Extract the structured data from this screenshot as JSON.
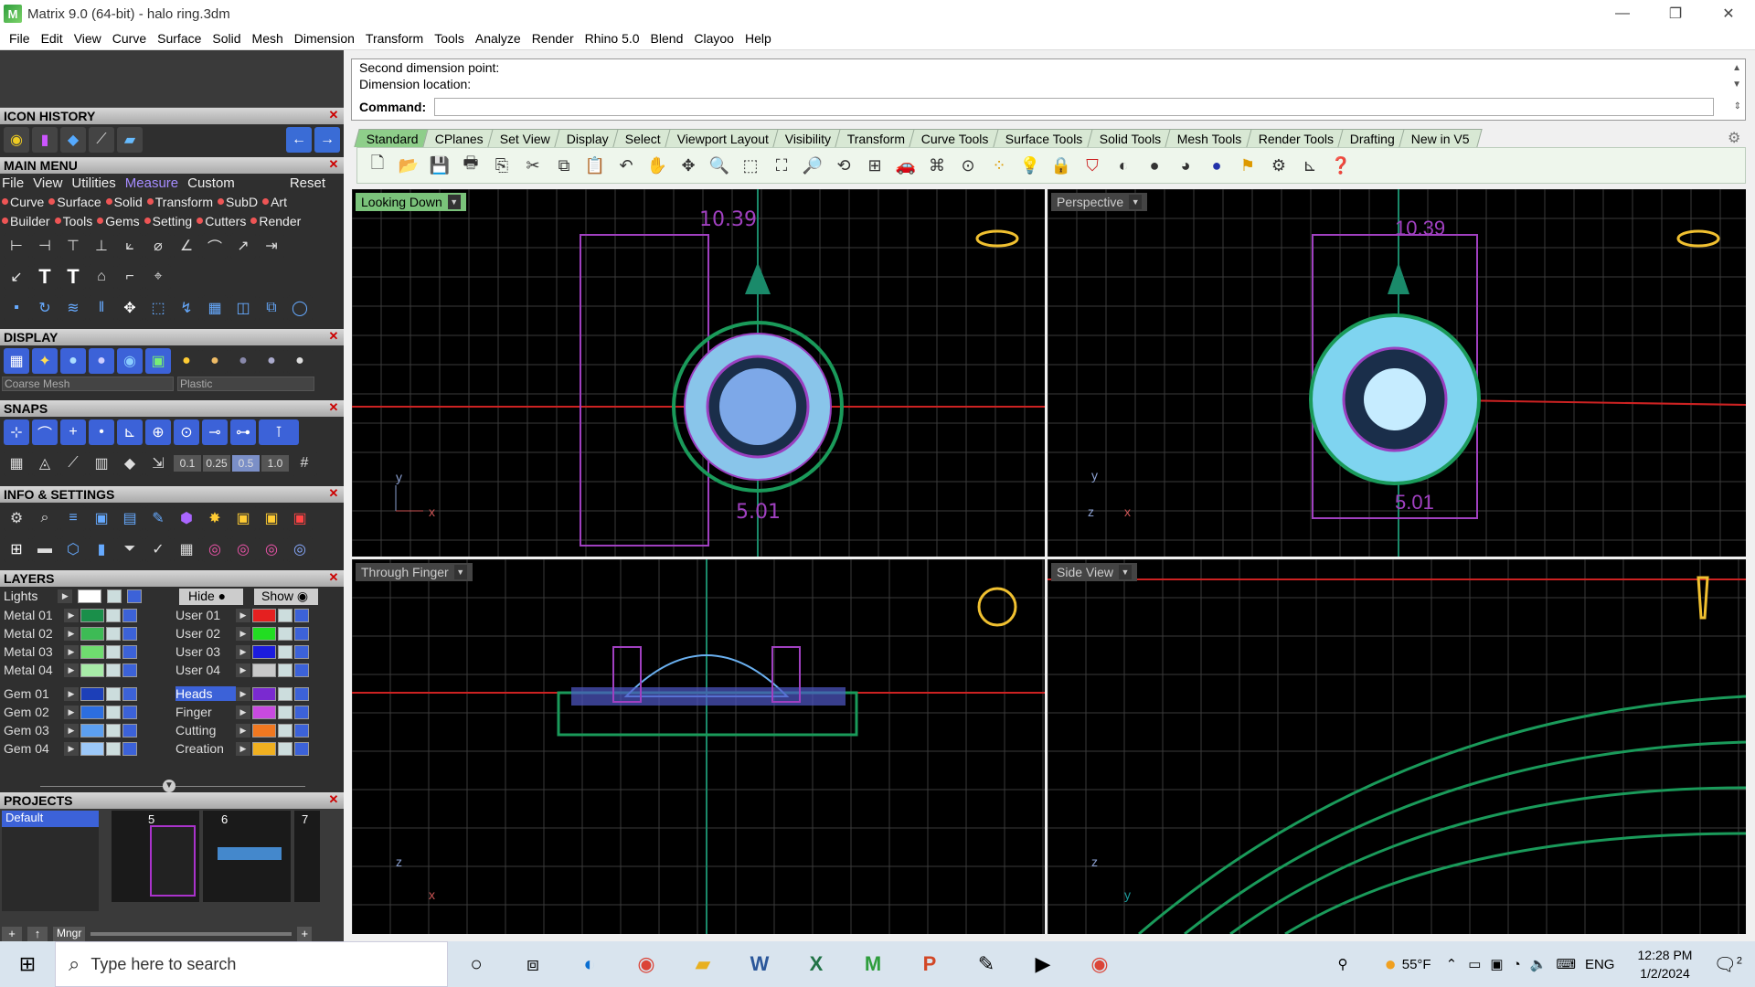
{
  "window": {
    "title": "Matrix 9.0 (64-bit) - halo ring.3dm",
    "min": "—",
    "max": "❐",
    "close": "✕"
  },
  "menubar": [
    "File",
    "Edit",
    "View",
    "Curve",
    "Surface",
    "Solid",
    "Mesh",
    "Dimension",
    "Transform",
    "Tools",
    "Analyze",
    "Render",
    "Rhino 5.0",
    "Blend",
    "Clayoo",
    "Help"
  ],
  "panels": {
    "icon_history": "ICON HISTORY",
    "main_menu": "MAIN MENU",
    "display": "DISPLAY",
    "snaps": "SNAPS",
    "info": "INFO & SETTINGS",
    "layers": "LAYERS",
    "projects": "PROJECTS"
  },
  "main_menu": {
    "tabs": [
      "File",
      "View",
      "Utilities",
      "Measure",
      "Custom"
    ],
    "reset": "Reset",
    "cats1": [
      "Curve",
      "Surface",
      "Solid",
      "Transform",
      "SubD",
      "Art"
    ],
    "cats2": [
      "Builder",
      "Tools",
      "Gems",
      "Setting",
      "Cutters",
      "Render"
    ]
  },
  "display": {
    "mesh_select": "Coarse Mesh",
    "material_select": "Plastic"
  },
  "snaps": {
    "vals": [
      "0.1",
      "0.25",
      "0.5",
      "1.0"
    ]
  },
  "layers": {
    "lights": "Lights",
    "hide": "Hide",
    "show": "Show",
    "left": [
      "Metal 01",
      "Metal 02",
      "Metal 03",
      "Metal 04",
      "Gem 01",
      "Gem 02",
      "Gem 03",
      "Gem 04"
    ],
    "right": [
      "User 01",
      "User 02",
      "User 03",
      "User 04",
      "Heads",
      "Finger",
      "Cutting",
      "Creation"
    ],
    "left_colors": [
      "#1a8f4a",
      "#3dbb55",
      "#6fdc6f",
      "#a7eba7",
      "#1c3fb8",
      "#2c6ee0",
      "#5c9ff0",
      "#9cc8f8"
    ],
    "right_colors": [
      "#e52020",
      "#22dd22",
      "#1c1cdd",
      "#c8c8c8",
      "#7a2ad0",
      "#c84ae0",
      "#f07820",
      "#f0b020"
    ]
  },
  "projects": {
    "default": "Default",
    "slots": [
      "5",
      "6",
      "7"
    ],
    "mngr": "Mngr"
  },
  "command": {
    "line1": "Second dimension point:",
    "line2": "Dimension location:",
    "prompt": "Command:"
  },
  "tabs": [
    "Standard",
    "CPlanes",
    "Set View",
    "Display",
    "Select",
    "Viewport Layout",
    "Visibility",
    "Transform",
    "Curve Tools",
    "Surface Tools",
    "Solid Tools",
    "Mesh Tools",
    "Render Tools",
    "Drafting",
    "New in V5"
  ],
  "viewports": {
    "top_left": {
      "label": "Looking Down",
      "dim_top": "10.39",
      "dim_bottom": "5.01",
      "ax1": "y",
      "ax2": "x"
    },
    "top_right": {
      "label": "Perspective",
      "dim_top": "10.39",
      "dim_bottom": "5.01",
      "ax1": "y",
      "ax2": "x",
      "ax3": "z"
    },
    "bottom_left": {
      "label": "Through Finger",
      "ax1": "z",
      "ax2": "x"
    },
    "bottom_right": {
      "label": "Side View",
      "ax1": "z",
      "ax2": "y"
    }
  },
  "taskbar": {
    "search": "Type here to search",
    "temp": "55°F",
    "lang": "ENG",
    "time": "12:28 PM",
    "date": "1/2/2024",
    "notif": "2"
  }
}
